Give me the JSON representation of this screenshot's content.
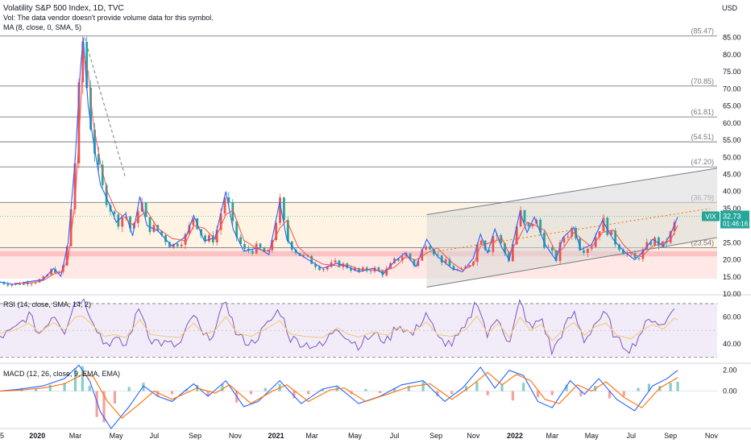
{
  "header": {
    "title": "Volatility S&P 500 Index, 1D, TVC",
    "volume_note": "Vol: The data vendor doesn't provide volume data for this symbol.",
    "ma_label": "MA (8, close, 0, SMA, 5)"
  },
  "colors": {
    "candle_up": "#26a69a",
    "candle_down": "#ef5350",
    "ma_line": "#2962ff",
    "signal_line": "#ff6d00",
    "rsi_line": "#7e57c2",
    "rsi_ma": "#f5c97a",
    "channel_fill": "#d8d8d8",
    "price_badge": "#26a69a"
  },
  "chart_data": [
    {
      "type": "line",
      "name": "price-pane",
      "currency": "USD",
      "y_ticks": [
        "85.00",
        "80.00",
        "75.00",
        "70.00",
        "65.00",
        "60.00",
        "55.00",
        "50.00",
        "45.00",
        "40.00",
        "35.00",
        "30.00",
        "25.00",
        "20.00",
        "15.00",
        "10.00"
      ],
      "ylim": [
        10,
        88
      ],
      "x_ticks": [
        "5",
        "2020",
        "Mar",
        "May",
        "Jul",
        "Sep",
        "Nov",
        "2021",
        "Mar",
        "May",
        "Jul",
        "Sep",
        "Nov",
        "2022",
        "Mar",
        "May",
        "Jul",
        "Sep",
        "Nov"
      ],
      "xlim": [
        0,
        100
      ],
      "fib_levels": [
        {
          "label": "(85.47)",
          "value": 85.47
        },
        {
          "label": "(70.85)",
          "value": 70.85
        },
        {
          "label": "(61.81)",
          "value": 61.81
        },
        {
          "label": "(54.51)",
          "value": 54.51
        },
        {
          "label": "(47.20)",
          "value": 47.2
        },
        {
          "label": "(36.79)",
          "value": 36.79
        },
        {
          "label": "(23.54)",
          "value": 23.54
        }
      ],
      "last_price": {
        "symbol": "VIX",
        "value": "32.73",
        "countdown": "01:46:16",
        "level": 32.73
      },
      "channel": {
        "upper": [
          {
            "x": 59.5,
            "y": 33.2
          },
          {
            "x": 100,
            "y": 46.8
          }
        ],
        "lower": [
          {
            "x": 59.5,
            "y": 12.0
          },
          {
            "x": 100,
            "y": 26.5
          }
        ]
      },
      "vix_series": [
        {
          "x": 0,
          "y": 13.5
        },
        {
          "x": 2,
          "y": 12.8
        },
        {
          "x": 4,
          "y": 13.6
        },
        {
          "x": 6,
          "y": 14.2
        },
        {
          "x": 7.5,
          "y": 17.5
        },
        {
          "x": 8.5,
          "y": 15.2
        },
        {
          "x": 9.5,
          "y": 25.0
        },
        {
          "x": 10.5,
          "y": 50.0
        },
        {
          "x": 11.2,
          "y": 75.5
        },
        {
          "x": 11.6,
          "y": 85.0
        },
        {
          "x": 12.3,
          "y": 65.0
        },
        {
          "x": 13.0,
          "y": 55.0
        },
        {
          "x": 14.0,
          "y": 42.0
        },
        {
          "x": 15.0,
          "y": 37.5
        },
        {
          "x": 16.2,
          "y": 31.0
        },
        {
          "x": 17.5,
          "y": 33.5
        },
        {
          "x": 18.5,
          "y": 27.0
        },
        {
          "x": 19.5,
          "y": 38.5
        },
        {
          "x": 20.5,
          "y": 30.0
        },
        {
          "x": 22,
          "y": 28.5
        },
        {
          "x": 24,
          "y": 24.0
        },
        {
          "x": 26,
          "y": 27.0
        },
        {
          "x": 27,
          "y": 33.0
        },
        {
          "x": 28.5,
          "y": 25.5
        },
        {
          "x": 30,
          "y": 26.5
        },
        {
          "x": 31.5,
          "y": 40.0
        },
        {
          "x": 32.5,
          "y": 29.0
        },
        {
          "x": 34,
          "y": 22.5
        },
        {
          "x": 36,
          "y": 23.5
        },
        {
          "x": 37.5,
          "y": 21.5
        },
        {
          "x": 39,
          "y": 37.0
        },
        {
          "x": 40,
          "y": 26.0
        },
        {
          "x": 41.5,
          "y": 22.0
        },
        {
          "x": 43,
          "y": 20.0
        },
        {
          "x": 45,
          "y": 17.5
        },
        {
          "x": 47,
          "y": 19.0
        },
        {
          "x": 48.5,
          "y": 18.0
        },
        {
          "x": 50,
          "y": 16.5
        },
        {
          "x": 52,
          "y": 17.5
        },
        {
          "x": 53.5,
          "y": 16.0
        },
        {
          "x": 55,
          "y": 19.5
        },
        {
          "x": 56.5,
          "y": 22.0
        },
        {
          "x": 58,
          "y": 18.0
        },
        {
          "x": 59.5,
          "y": 26.0
        },
        {
          "x": 61,
          "y": 21.0
        },
        {
          "x": 63,
          "y": 17.5
        },
        {
          "x": 64.5,
          "y": 16.5
        },
        {
          "x": 66,
          "y": 20.5
        },
        {
          "x": 67,
          "y": 27.5
        },
        {
          "x": 68,
          "y": 22.0
        },
        {
          "x": 69,
          "y": 29.0
        },
        {
          "x": 70,
          "y": 23.5
        },
        {
          "x": 71,
          "y": 20.0
        },
        {
          "x": 72.5,
          "y": 34.0
        },
        {
          "x": 73.5,
          "y": 28.0
        },
        {
          "x": 74.5,
          "y": 32.5
        },
        {
          "x": 76,
          "y": 24.5
        },
        {
          "x": 77.5,
          "y": 20.0
        },
        {
          "x": 78.5,
          "y": 26.5
        },
        {
          "x": 80,
          "y": 29.5
        },
        {
          "x": 81,
          "y": 23.0
        },
        {
          "x": 82.5,
          "y": 24.5
        },
        {
          "x": 84,
          "y": 31.5
        },
        {
          "x": 85.5,
          "y": 26.0
        },
        {
          "x": 87,
          "y": 22.5
        },
        {
          "x": 88.5,
          "y": 20.0
        },
        {
          "x": 89.5,
          "y": 22.0
        },
        {
          "x": 91,
          "y": 26.0
        },
        {
          "x": 92.5,
          "y": 24.0
        },
        {
          "x": 93.5,
          "y": 27.5
        },
        {
          "x": 94.5,
          "y": 32.5
        }
      ]
    },
    {
      "type": "line",
      "name": "rsi-pane",
      "label": "RSI (14, close, SMA, 14, 2)",
      "y_ticks": [
        "60.00",
        "40.00"
      ],
      "ylim": [
        26,
        76
      ],
      "bands": [
        70,
        30
      ],
      "rsi_series": [
        {
          "x": 0,
          "y": 45
        },
        {
          "x": 2,
          "y": 50
        },
        {
          "x": 4,
          "y": 62
        },
        {
          "x": 5.5,
          "y": 47
        },
        {
          "x": 7.5,
          "y": 63
        },
        {
          "x": 9,
          "y": 50
        },
        {
          "x": 10.5,
          "y": 72
        },
        {
          "x": 11.5,
          "y": 74
        },
        {
          "x": 13,
          "y": 58
        },
        {
          "x": 14.5,
          "y": 40
        },
        {
          "x": 16,
          "y": 43
        },
        {
          "x": 17.5,
          "y": 38
        },
        {
          "x": 19.5,
          "y": 68
        },
        {
          "x": 21,
          "y": 43
        },
        {
          "x": 23,
          "y": 40
        },
        {
          "x": 25,
          "y": 38
        },
        {
          "x": 27,
          "y": 62
        },
        {
          "x": 28.5,
          "y": 43
        },
        {
          "x": 30,
          "y": 50
        },
        {
          "x": 31.5,
          "y": 73
        },
        {
          "x": 33,
          "y": 46
        },
        {
          "x": 35,
          "y": 40
        },
        {
          "x": 37,
          "y": 52
        },
        {
          "x": 39,
          "y": 66
        },
        {
          "x": 40.5,
          "y": 44
        },
        {
          "x": 42.5,
          "y": 40
        },
        {
          "x": 45,
          "y": 38
        },
        {
          "x": 47,
          "y": 54
        },
        {
          "x": 48.5,
          "y": 44
        },
        {
          "x": 50,
          "y": 39
        },
        {
          "x": 52,
          "y": 47
        },
        {
          "x": 54,
          "y": 42
        },
        {
          "x": 55.5,
          "y": 55
        },
        {
          "x": 57.5,
          "y": 46
        },
        {
          "x": 59.5,
          "y": 64
        },
        {
          "x": 61,
          "y": 43
        },
        {
          "x": 63,
          "y": 40
        },
        {
          "x": 65,
          "y": 52
        },
        {
          "x": 66.5,
          "y": 74
        },
        {
          "x": 68,
          "y": 45
        },
        {
          "x": 69.5,
          "y": 62
        },
        {
          "x": 71,
          "y": 38
        },
        {
          "x": 72.5,
          "y": 72
        },
        {
          "x": 74,
          "y": 50
        },
        {
          "x": 75.5,
          "y": 60
        },
        {
          "x": 77,
          "y": 33
        },
        {
          "x": 78.5,
          "y": 50
        },
        {
          "x": 80,
          "y": 63
        },
        {
          "x": 81.5,
          "y": 42
        },
        {
          "x": 83,
          "y": 56
        },
        {
          "x": 84.5,
          "y": 62
        },
        {
          "x": 86,
          "y": 42
        },
        {
          "x": 88,
          "y": 36
        },
        {
          "x": 89.5,
          "y": 50
        },
        {
          "x": 91,
          "y": 60
        },
        {
          "x": 92.5,
          "y": 52
        },
        {
          "x": 94,
          "y": 70
        },
        {
          "x": 94.5,
          "y": 68
        }
      ]
    },
    {
      "type": "bar",
      "name": "macd-pane",
      "label": "MACD (12, 26, close, 9, EMA, EMA)",
      "y_ticks": [
        "2.00",
        "0.00"
      ],
      "ylim": [
        -3.6,
        2.6
      ],
      "histogram": [
        {
          "x": 1,
          "y": 0.1
        },
        {
          "x": 3,
          "y": 0.3
        },
        {
          "x": 5,
          "y": 0.2
        },
        {
          "x": 7,
          "y": 0.6
        },
        {
          "x": 9,
          "y": 0.8
        },
        {
          "x": 10.5,
          "y": 2.2
        },
        {
          "x": 11.5,
          "y": 2.4
        },
        {
          "x": 12.5,
          "y": 0.5
        },
        {
          "x": 13.5,
          "y": -2.5
        },
        {
          "x": 14.5,
          "y": -3.0
        },
        {
          "x": 16,
          "y": -1.2
        },
        {
          "x": 18,
          "y": 0.4
        },
        {
          "x": 20,
          "y": 0.8
        },
        {
          "x": 22,
          "y": -0.5
        },
        {
          "x": 24,
          "y": -0.3
        },
        {
          "x": 26,
          "y": 0.2
        },
        {
          "x": 27.5,
          "y": 0.6
        },
        {
          "x": 29,
          "y": -0.5
        },
        {
          "x": 31,
          "y": 0.7
        },
        {
          "x": 33,
          "y": -1.1
        },
        {
          "x": 35,
          "y": -0.3
        },
        {
          "x": 37,
          "y": 0.3
        },
        {
          "x": 39,
          "y": 0.7
        },
        {
          "x": 41,
          "y": -0.7
        },
        {
          "x": 43,
          "y": -0.3
        },
        {
          "x": 45,
          "y": 0.2
        },
        {
          "x": 47,
          "y": 0.4
        },
        {
          "x": 49,
          "y": -0.3
        },
        {
          "x": 51,
          "y": 0.2
        },
        {
          "x": 53,
          "y": -0.2
        },
        {
          "x": 55,
          "y": 0.3
        },
        {
          "x": 57,
          "y": 0.5
        },
        {
          "x": 59,
          "y": 0.9
        },
        {
          "x": 61,
          "y": -0.5
        },
        {
          "x": 63,
          "y": -0.3
        },
        {
          "x": 65,
          "y": 0.5
        },
        {
          "x": 66.5,
          "y": 0.9
        },
        {
          "x": 68,
          "y": -0.4
        },
        {
          "x": 70,
          "y": 0.7
        },
        {
          "x": 71.5,
          "y": -0.9
        },
        {
          "x": 73,
          "y": 0.8
        },
        {
          "x": 75,
          "y": -0.6
        },
        {
          "x": 77,
          "y": -0.4
        },
        {
          "x": 79,
          "y": 0.6
        },
        {
          "x": 81,
          "y": -0.5
        },
        {
          "x": 83,
          "y": 0.5
        },
        {
          "x": 85,
          "y": -0.7
        },
        {
          "x": 87,
          "y": -0.5
        },
        {
          "x": 89,
          "y": 0.3
        },
        {
          "x": 90.5,
          "y": 0.7
        },
        {
          "x": 92,
          "y": 0.5
        },
        {
          "x": 93.5,
          "y": 0.8
        },
        {
          "x": 94.5,
          "y": 0.9
        }
      ],
      "macd_series": [
        {
          "x": 0,
          "y": 0.0
        },
        {
          "x": 3,
          "y": 0.2
        },
        {
          "x": 6,
          "y": 0.5
        },
        {
          "x": 9,
          "y": 1.2
        },
        {
          "x": 11,
          "y": 2.5
        },
        {
          "x": 12.5,
          "y": 1.0
        },
        {
          "x": 14,
          "y": -2.0
        },
        {
          "x": 15.5,
          "y": -3.6
        },
        {
          "x": 18,
          "y": -1.5
        },
        {
          "x": 20,
          "y": 0.5
        },
        {
          "x": 22,
          "y": -0.5
        },
        {
          "x": 24,
          "y": -1.0
        },
        {
          "x": 27,
          "y": 0.7
        },
        {
          "x": 29,
          "y": -0.5
        },
        {
          "x": 31.5,
          "y": 1.0
        },
        {
          "x": 34,
          "y": -1.5
        },
        {
          "x": 36,
          "y": -1.0
        },
        {
          "x": 39,
          "y": 1.0
        },
        {
          "x": 42,
          "y": -1.2
        },
        {
          "x": 45,
          "y": 0.2
        },
        {
          "x": 47,
          "y": 0.5
        },
        {
          "x": 50,
          "y": -1.2
        },
        {
          "x": 53,
          "y": -0.5
        },
        {
          "x": 56,
          "y": 0.6
        },
        {
          "x": 59,
          "y": 1.0
        },
        {
          "x": 62,
          "y": -1.0
        },
        {
          "x": 64.5,
          "y": 0.3
        },
        {
          "x": 67,
          "y": 2.3
        },
        {
          "x": 69,
          "y": 0.3
        },
        {
          "x": 71,
          "y": 2.0
        },
        {
          "x": 73,
          "y": 1.5
        },
        {
          "x": 75,
          "y": -1.0
        },
        {
          "x": 77,
          "y": -1.6
        },
        {
          "x": 79.5,
          "y": 1.0
        },
        {
          "x": 81.5,
          "y": -0.3
        },
        {
          "x": 83.5,
          "y": 1.2
        },
        {
          "x": 86,
          "y": -0.8
        },
        {
          "x": 88.5,
          "y": -1.9
        },
        {
          "x": 91,
          "y": 0.5
        },
        {
          "x": 93,
          "y": 1.2
        },
        {
          "x": 94.5,
          "y": 2.0
        }
      ],
      "signal_series": [
        {
          "x": 0,
          "y": 0.0
        },
        {
          "x": 3,
          "y": 0.1
        },
        {
          "x": 6,
          "y": 0.3
        },
        {
          "x": 9,
          "y": 0.7
        },
        {
          "x": 11.5,
          "y": 1.6
        },
        {
          "x": 13,
          "y": 1.4
        },
        {
          "x": 15,
          "y": -1.0
        },
        {
          "x": 17,
          "y": -2.6
        },
        {
          "x": 19.5,
          "y": -1.2
        },
        {
          "x": 21.5,
          "y": 0.0
        },
        {
          "x": 24,
          "y": -0.8
        },
        {
          "x": 27.5,
          "y": 0.3
        },
        {
          "x": 30,
          "y": -0.2
        },
        {
          "x": 32,
          "y": 0.6
        },
        {
          "x": 35,
          "y": -1.2
        },
        {
          "x": 38,
          "y": 0.0
        },
        {
          "x": 40,
          "y": 0.6
        },
        {
          "x": 43,
          "y": -1.0
        },
        {
          "x": 46,
          "y": 0.1
        },
        {
          "x": 48,
          "y": 0.3
        },
        {
          "x": 51,
          "y": -1.0
        },
        {
          "x": 54,
          "y": -0.3
        },
        {
          "x": 57,
          "y": 0.4
        },
        {
          "x": 60,
          "y": 0.7
        },
        {
          "x": 63,
          "y": -0.8
        },
        {
          "x": 65.5,
          "y": 0.4
        },
        {
          "x": 68,
          "y": 1.8
        },
        {
          "x": 70,
          "y": 0.6
        },
        {
          "x": 72,
          "y": 1.6
        },
        {
          "x": 74,
          "y": 1.0
        },
        {
          "x": 76,
          "y": -0.8
        },
        {
          "x": 78,
          "y": -1.2
        },
        {
          "x": 80.5,
          "y": 0.6
        },
        {
          "x": 82.5,
          "y": 0.0
        },
        {
          "x": 84.5,
          "y": 0.9
        },
        {
          "x": 87,
          "y": -0.6
        },
        {
          "x": 89.5,
          "y": -1.6
        },
        {
          "x": 92,
          "y": 0.3
        },
        {
          "x": 94.5,
          "y": 1.3
        }
      ]
    }
  ]
}
